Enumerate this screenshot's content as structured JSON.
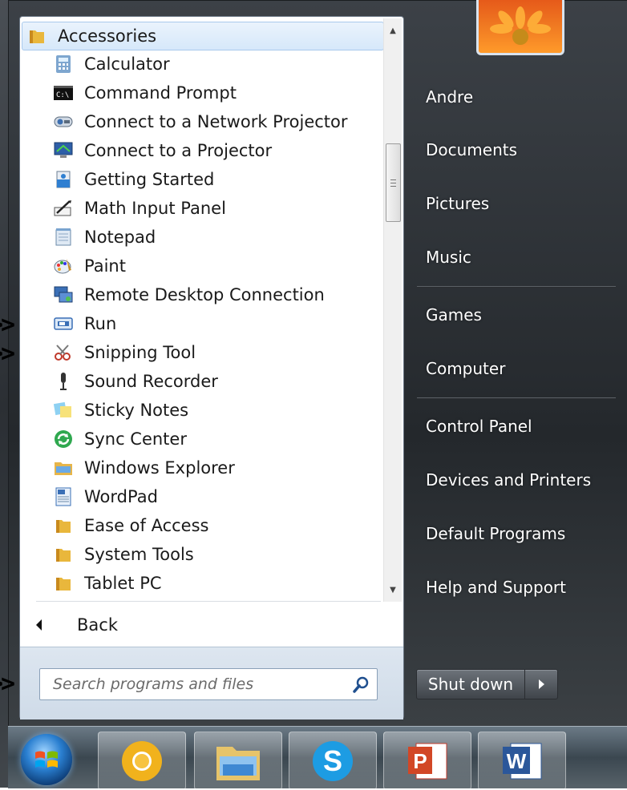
{
  "programs": {
    "folder_label": "Accessories",
    "items": [
      {
        "label": "Calculator"
      },
      {
        "label": "Command Prompt"
      },
      {
        "label": "Connect to a Network Projector"
      },
      {
        "label": "Connect to a Projector"
      },
      {
        "label": "Getting Started"
      },
      {
        "label": "Math Input Panel"
      },
      {
        "label": "Notepad"
      },
      {
        "label": "Paint"
      },
      {
        "label": "Remote Desktop Connection"
      },
      {
        "label": "Run"
      },
      {
        "label": "Snipping Tool"
      },
      {
        "label": "Sound Recorder"
      },
      {
        "label": "Sticky Notes"
      },
      {
        "label": "Sync Center"
      },
      {
        "label": "Windows Explorer"
      },
      {
        "label": "WordPad"
      },
      {
        "label": "Ease of Access"
      },
      {
        "label": "System Tools"
      },
      {
        "label": "Tablet PC"
      }
    ]
  },
  "back_label": "Back",
  "search": {
    "placeholder": "Search programs and files"
  },
  "right_pane": {
    "user": "Andre",
    "documents": "Documents",
    "pictures": "Pictures",
    "music": "Music",
    "games": "Games",
    "computer": "Computer",
    "control_panel": "Control Panel",
    "devices_printers": "Devices and Printers",
    "default_programs": "Default Programs",
    "help_support": "Help and Support"
  },
  "shutdown_label": "Shut down",
  "annotations": {
    "arrow1": ">>",
    "arrow2": ">>",
    "arrow3": ">>"
  },
  "taskbar": {
    "apps": [
      "chrome-icon",
      "file-explorer-icon",
      "skype-icon",
      "powerpoint-icon",
      "word-icon"
    ]
  }
}
